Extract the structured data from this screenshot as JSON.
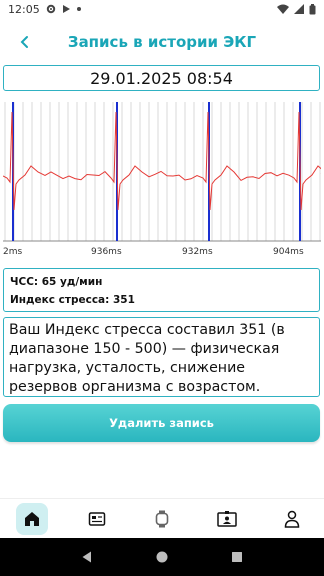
{
  "status_bar": {
    "time": "12:05",
    "left_icons": [
      "gear-icon",
      "play-store-icon",
      "dot-icon"
    ],
    "right_icons": [
      "wifi-icon",
      "signal-icon",
      "battery-icon"
    ]
  },
  "header": {
    "back_icon": "chevron-left-icon",
    "title": "Запись в истории ЭКГ"
  },
  "record": {
    "datetime": "29.01.2025 08:54"
  },
  "ecg_chart": {
    "interval_labels": [
      "2ms",
      "936ms",
      "932ms",
      "904ms"
    ],
    "colors": {
      "signal": "#e53935",
      "r_marker": "#1a2fd0",
      "grid": "#c8c8c8"
    }
  },
  "stats": {
    "hr": "ЧСС: 65 уд/мин",
    "stress": "Индекс стресса: 351"
  },
  "description": "Ваш Индекс стресса составил 351 (в диапазоне 150 - 500) — физическая нагрузка, усталость, снижение резервов организма с возрастом.",
  "actions": {
    "delete_label": "Удалить запись"
  },
  "bottom_nav": {
    "items": [
      {
        "icon": "home-icon",
        "active": true
      },
      {
        "icon": "news-icon",
        "active": false
      },
      {
        "icon": "watch-icon",
        "active": false
      },
      {
        "icon": "id-card-icon",
        "active": false
      },
      {
        "icon": "profile-icon",
        "active": false
      }
    ]
  },
  "system_nav": [
    "back-triangle-icon",
    "home-circle-icon",
    "recents-square-icon"
  ],
  "colors": {
    "accent": "#1aa6b7",
    "button": "#2ab6bf",
    "border": "#2fb1c2"
  }
}
